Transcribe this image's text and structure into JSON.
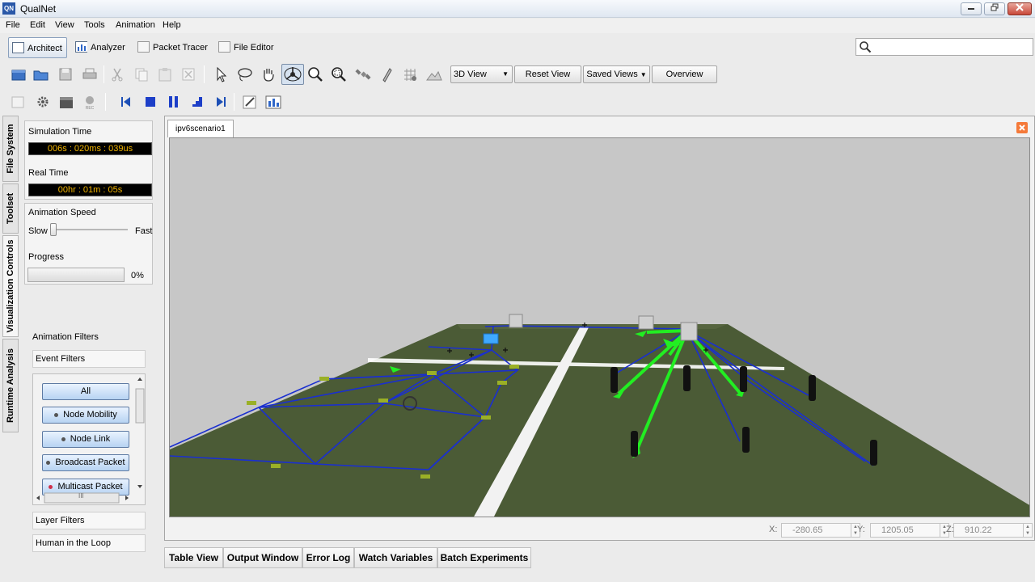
{
  "window": {
    "title": "QualNet",
    "logo": "QN",
    "controls": [
      "minimize-icon",
      "restore-icon",
      "close-icon"
    ]
  },
  "menu": [
    "File",
    "Edit",
    "View",
    "Tools",
    "Animation",
    "Help"
  ],
  "perspectives": [
    {
      "label": "Architect",
      "icon": "architect-icon",
      "active": true
    },
    {
      "label": "Analyzer",
      "icon": "chart-icon",
      "active": false
    },
    {
      "label": "Packet Tracer",
      "icon": "packet-tracer-icon",
      "active": false
    },
    {
      "label": "File Editor",
      "icon": "file-editor-icon",
      "active": false
    }
  ],
  "search": {
    "placeholder": "",
    "value": "",
    "icon": "search-icon"
  },
  "toolbar": {
    "view_select": "3D View",
    "reset_view": "Reset View",
    "saved_views": "Saved Views",
    "overview": "Overview"
  },
  "vertical_tabs": [
    "File System",
    "Toolset",
    "Visualization Controls",
    "Runtime Analysis"
  ],
  "visualization": {
    "sim_time_label": "Simulation Time",
    "sim_time_value": "006s : 020ms : 039us",
    "real_time_label": "Real Time",
    "real_time_value": "00hr : 01m : 05s",
    "speed_label": "Animation Speed",
    "speed_slow": "Slow",
    "speed_fast": "Fast",
    "speed_level": 0.0,
    "progress_label": "Progress",
    "progress_value": "0%",
    "progress_fraction": 0.0
  },
  "filters": {
    "animation_filters": "Animation Filters",
    "event_filters": "Event Filters",
    "buttons": [
      "All",
      "Node Mobility",
      "Node Link",
      "Broadcast Packet",
      "Multicast Packet"
    ],
    "scroll_glyph": "III",
    "layer_filters": "Layer Filters",
    "human_in_loop": "Human in the Loop"
  },
  "editor": {
    "tab_label": "ipv6scenario1",
    "coords": {
      "x_label": "X:",
      "x": "-280.65",
      "y_label": "Y:",
      "y": "1205.05",
      "z_label": "Z:",
      "z": "910.22"
    }
  },
  "bottom_tabs": [
    "Table View",
    "Output Window",
    "Error Log",
    "Watch Variables",
    "Batch Experiments"
  ],
  "colors": {
    "lcd_text": "#f2b400",
    "terrain": "#4b5b36",
    "link_blue": "#1a2fd0",
    "broadcast_green": "#22ee22",
    "sky": "#c7c7c7"
  }
}
